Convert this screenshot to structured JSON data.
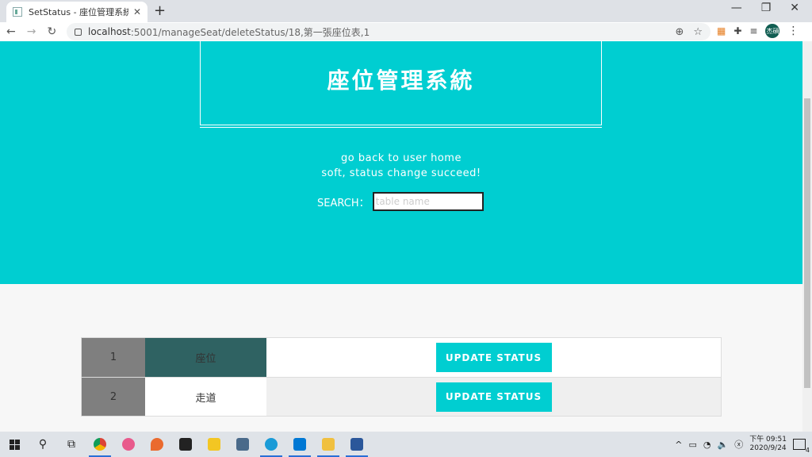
{
  "browser": {
    "tab_title": "SetStatus - 座位管理系統",
    "tab_close": "✕",
    "new_tab": "+",
    "url_host": "localhost",
    "url_path": ":5001/manageSeat/deleteStatus/18,第一張座位表,1",
    "avatar_text": "杰碩"
  },
  "page": {
    "title": "座位管理系統",
    "home_link": "go back to user home",
    "status_message": "soft, status change succeed!",
    "search_label": "SEARCH：",
    "search_placeholder": "table name"
  },
  "table": {
    "rows": [
      {
        "number": "1",
        "type": "座位",
        "button": "UPDATE STATUS"
      },
      {
        "number": "2",
        "type": "走道",
        "button": "UPDATE STATUS"
      }
    ]
  },
  "taskbar": {
    "time": "下午 09:51",
    "date": "2020/9/24",
    "notifications": "4"
  },
  "colors": {
    "accent": "#00ced1",
    "seat": "#2f6262",
    "number_cell": "#7f7f7f"
  }
}
